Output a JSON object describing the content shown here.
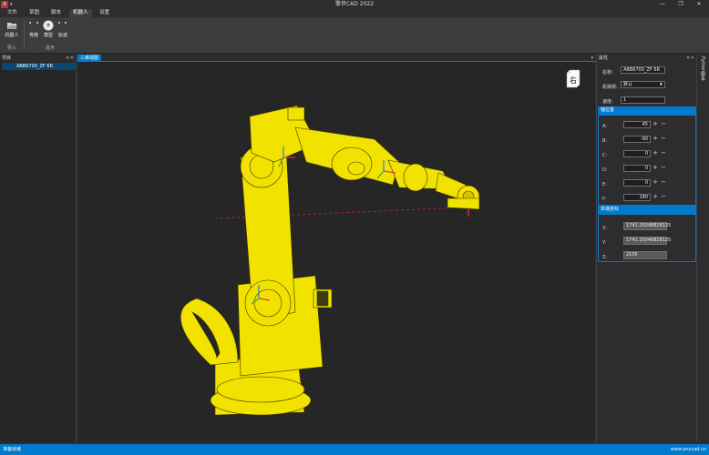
{
  "window": {
    "title": "擎世CAD 2022",
    "icon_label": "A",
    "minimize_glyph": "—",
    "restore_glyph": "❐",
    "close_glyph": "✕"
  },
  "menu": {
    "items": [
      "文件",
      "草图",
      "脚本",
      "机器人",
      "设置"
    ],
    "active_index": 3
  },
  "ribbon": {
    "import_group": {
      "button_label": "机器人",
      "group_label": "导入"
    },
    "display_group": {
      "buttons": [
        "骨骼",
        "模型",
        "轨迹"
      ],
      "group_label": "显示"
    }
  },
  "left_panel": {
    "title": "项目",
    "pin_glyph": "▾ ✕",
    "items": [
      {
        "label": "ABB6700_ZF 6R"
      }
    ]
  },
  "view_tab": {
    "label": "三维视图",
    "pin_glyph": "▾"
  },
  "viewcube": {
    "face_label": "右"
  },
  "properties": {
    "title": "属性",
    "pin_glyph": "▾ ✕",
    "name_label": "名称:",
    "name_value": "ABB6700_ZF 6R",
    "arm_label": "机械臂:",
    "arm_value": "默认",
    "speed_label": "速度:",
    "speed_value": "1",
    "axis_section": "轴位置",
    "axes": [
      {
        "label": "A:",
        "value": "45"
      },
      {
        "label": "B:",
        "value": "-90"
      },
      {
        "label": "C:",
        "value": "0"
      },
      {
        "label": "D:",
        "value": "0"
      },
      {
        "label": "E:",
        "value": "0"
      },
      {
        "label": "F:",
        "value": "180"
      }
    ],
    "end_section": "末端坐标",
    "coords": [
      {
        "label": "X:",
        "value": "1741.25048828125"
      },
      {
        "label": "Y:",
        "value": "1741.25048828125"
      },
      {
        "label": "Z:",
        "value": "2105"
      }
    ]
  },
  "side_strip": {
    "label": "Python脚本"
  },
  "status": {
    "left": "准备就绪",
    "right": "www.anycad.cn"
  },
  "colors": {
    "accent": "#007acc",
    "robot": "#f2e200",
    "robot_edge": "#3a3600",
    "viewport_bg": "#262626"
  }
}
